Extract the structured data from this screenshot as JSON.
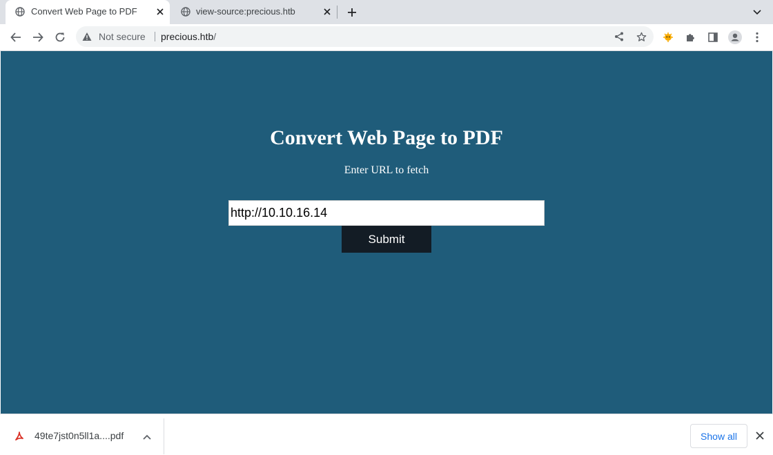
{
  "browser": {
    "tabs": [
      {
        "title": "Convert Web Page to PDF",
        "active": true
      },
      {
        "title": "view-source:precious.htb",
        "active": false
      }
    ],
    "omnibox": {
      "security_label": "Not secure",
      "host": "precious.htb",
      "path": "/"
    },
    "colors": {
      "tabstrip": "#dee1e6",
      "extension_accent": "#f9ab00"
    }
  },
  "page": {
    "title": "Convert Web Page to PDF",
    "subtitle": "Enter URL to fetch",
    "url_input": {
      "value": "http://10.10.16.14",
      "placeholder": ""
    },
    "submit_label": "Submit",
    "colors": {
      "background": "#1f5c7a",
      "button": "#131c25"
    }
  },
  "download_bar": {
    "file_name": "49te7jst0n5ll1a....pdf",
    "show_all_label": "Show all"
  },
  "icons": {
    "tab_favicon": "globe-icon",
    "back": "arrow-left-icon",
    "forward": "arrow-right-icon",
    "reload": "reload-icon",
    "warning": "warning-triangle-icon",
    "share": "share-icon",
    "bookmark": "star-icon",
    "extensions": "puzzle-icon",
    "side_panel": "side-panel-icon",
    "profile": "profile-icon",
    "menu": "kebab-menu-icon",
    "pdf": "pdf-file-icon"
  }
}
